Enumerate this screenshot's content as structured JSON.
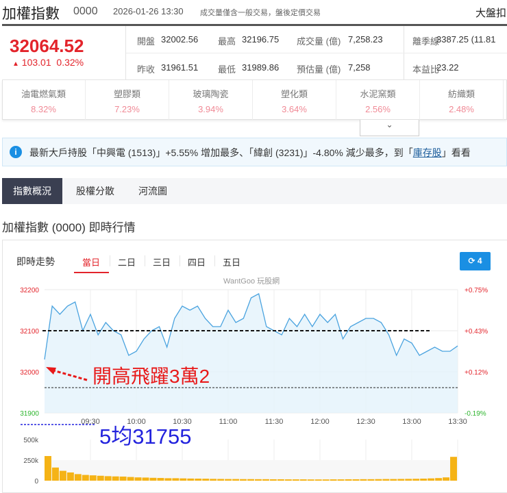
{
  "header": {
    "title": "加權指數",
    "code": "0000",
    "datetime": "2026-01-26 13:30",
    "note": "成交量僅含一般交易，盤後定價交易",
    "right_label": "大盤扣"
  },
  "quote": {
    "price": "32064.52",
    "change": "103.01",
    "change_pct": "0.32%",
    "rows": [
      [
        {
          "label": "開盤",
          "value": "32002.56"
        },
        {
          "label": "最高",
          "value": "32196.75"
        },
        {
          "label": "成交量 (億)",
          "value": "7,258.23"
        },
        {
          "label": "離季線",
          "value": "3387.25 (11.81"
        }
      ],
      [
        {
          "label": "昨收",
          "value": "31961.51"
        },
        {
          "label": "最低",
          "value": "31989.86"
        },
        {
          "label": "預估量 (億)",
          "value": "7,258"
        },
        {
          "label": "本益比",
          "value": "23.22"
        }
      ]
    ]
  },
  "sectors": [
    {
      "name": "油電燃氣類",
      "pct": "8.32%"
    },
    {
      "name": "塑膠類",
      "pct": "7.23%"
    },
    {
      "name": "玻璃陶瓷",
      "pct": "3.94%"
    },
    {
      "name": "塑化類",
      "pct": "3.64%"
    },
    {
      "name": "水泥窯類",
      "pct": "2.56%"
    },
    {
      "name": "紡織類",
      "pct": "2.48%"
    }
  ],
  "expand_icon": "chevron-down-icon",
  "info": {
    "text_before": "最新大戶持股「中興電 (1513)」+5.55% 增加最多、「緯創 (3231)」-4.80% 減少最多，到「",
    "link": "庫存股",
    "text_after": "」看看"
  },
  "tabs": [
    {
      "label": "指數概況",
      "active": true
    },
    {
      "label": "股權分散"
    },
    {
      "label": "河流圖"
    }
  ],
  "section_title": "加權指數 (0000) 即時行情",
  "panel": {
    "title": "即時走勢",
    "periods": [
      "當日",
      "二日",
      "三日",
      "四日",
      "五日"
    ],
    "active_period": "當日",
    "refresh_count": "4",
    "watermark": "WantGoo 玩股網"
  },
  "annotations": {
    "red": "開高飛躍3萬2",
    "blue": "5均31755"
  },
  "colors": {
    "up": "#e3242b",
    "down": "#2db52d",
    "line": "#4aa3df",
    "volume": "#f5b316",
    "accent": "#1a8fe3"
  },
  "chart_data": [
    {
      "type": "line",
      "title": "即時走勢",
      "x": [
        "09:00",
        "09:05",
        "09:10",
        "09:15",
        "09:20",
        "09:25",
        "09:30",
        "09:35",
        "09:40",
        "09:45",
        "09:50",
        "09:55",
        "10:00",
        "10:05",
        "10:10",
        "10:15",
        "10:20",
        "10:25",
        "10:30",
        "10:35",
        "10:40",
        "10:45",
        "10:50",
        "10:55",
        "11:00",
        "11:05",
        "11:10",
        "11:15",
        "11:20",
        "11:25",
        "11:30",
        "11:35",
        "11:40",
        "11:45",
        "11:50",
        "11:55",
        "12:00",
        "12:05",
        "12:10",
        "12:15",
        "12:20",
        "12:25",
        "12:30",
        "12:35",
        "12:40",
        "12:45",
        "12:50",
        "12:55",
        "13:00",
        "13:05",
        "13:10",
        "13:15",
        "13:20",
        "13:25",
        "13:30"
      ],
      "values": [
        32030,
        32160,
        32140,
        32160,
        32170,
        32100,
        32140,
        32090,
        32120,
        32100,
        32090,
        32040,
        32050,
        32080,
        32100,
        32110,
        32060,
        32130,
        32160,
        32150,
        32160,
        32130,
        32110,
        32110,
        32150,
        32120,
        32130,
        32180,
        32190,
        32110,
        32100,
        32090,
        32130,
        32110,
        32140,
        32110,
        32140,
        32120,
        32140,
        32080,
        32110,
        32120,
        32130,
        32130,
        32120,
        32090,
        32040,
        32080,
        32070,
        32040,
        32050,
        32060,
        32050,
        32050,
        32063
      ],
      "ylim": [
        31900,
        32200
      ],
      "y_ticks": [
        "32200",
        "32100",
        "32000",
        "31900"
      ],
      "y2_ticks": [
        "+0.75%",
        "+0.43%",
        "+0.12%",
        "-0.19%"
      ],
      "x_ticks": [
        "09:30",
        "10:00",
        "10:30",
        "11:00",
        "11:30",
        "12:00",
        "12:30",
        "13:00",
        "13:30"
      ],
      "reference_lines": [
        {
          "value": 32100,
          "style": "bold-dashed"
        },
        {
          "value": 31961.51,
          "style": "dashed"
        },
        {
          "value": 31755,
          "style": "blue-dashed"
        }
      ]
    },
    {
      "type": "bar",
      "title": "成交量",
      "values": [
        300000,
        160000,
        120000,
        100000,
        80000,
        70000,
        65000,
        60000,
        55000,
        52000,
        50000,
        45000,
        40000,
        38000,
        35000,
        33000,
        30000,
        30000,
        28000,
        26000,
        25000,
        24000,
        22000,
        21000,
        20000,
        20000,
        19000,
        19000,
        18000,
        18000,
        17000,
        17000,
        16000,
        16000,
        16000,
        15000,
        15000,
        15000,
        16000,
        16000,
        17000,
        17000,
        18000,
        18000,
        19000,
        20000,
        20000,
        21000,
        22000,
        23000,
        25000,
        28000,
        32000,
        40000,
        290000
      ],
      "ylim": [
        0,
        500000
      ],
      "y_ticks": [
        "500k",
        "250k",
        "0"
      ]
    }
  ]
}
